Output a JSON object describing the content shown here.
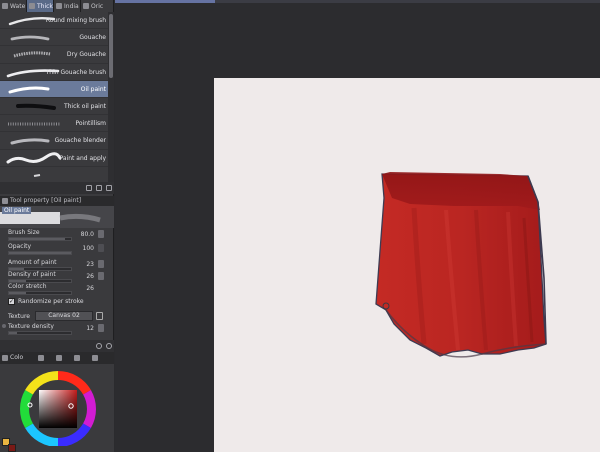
{
  "tool_tabs": [
    {
      "label": "Wate",
      "active": false
    },
    {
      "label": "Thick",
      "active": true
    },
    {
      "label": "India",
      "active": false
    },
    {
      "label": "Oric",
      "active": false
    }
  ],
  "brushes": [
    {
      "label": "Round mixing brush",
      "selected": false
    },
    {
      "label": "Gouache",
      "selected": false
    },
    {
      "label": "Dry Gouache",
      "selected": false
    },
    {
      "label": "Thin Gouache brush",
      "selected": false
    },
    {
      "label": "Oil paint",
      "selected": true
    },
    {
      "label": "Thick oil paint",
      "selected": false
    },
    {
      "label": "Pointillism",
      "selected": false
    },
    {
      "label": "Gouache blender",
      "selected": false
    },
    {
      "label": "Paint and apply",
      "selected": false
    },
    {
      "label": "",
      "selected": false
    }
  ],
  "tool_property": {
    "header": "Tool property [Oil paint]",
    "tool_name": "Oil paint",
    "brush_size": {
      "label": "Brush Size",
      "value": "80.0"
    },
    "opacity": {
      "label": "Opacity",
      "value": "100"
    },
    "amount_of_paint": {
      "label": "Amount of paint",
      "value": "23"
    },
    "density_of_paint": {
      "label": "Density of paint",
      "value": "26"
    },
    "color_stretch": {
      "label": "Color stretch",
      "value": "26"
    },
    "randomize": {
      "label": "Randomize per stroke",
      "checked": true
    },
    "texture": {
      "label": "Texture",
      "value": "Canvas 02"
    },
    "texture_density": {
      "label": "Texture density",
      "value": "12"
    }
  },
  "color_panel": {
    "tab_label": "Colo",
    "main_color": "#e9b441",
    "sub_color": "#7a1a16",
    "selected_color": "#b11e1e"
  },
  "canvas": {
    "background": "#efeaea",
    "paint_color": "#b11e1e"
  }
}
